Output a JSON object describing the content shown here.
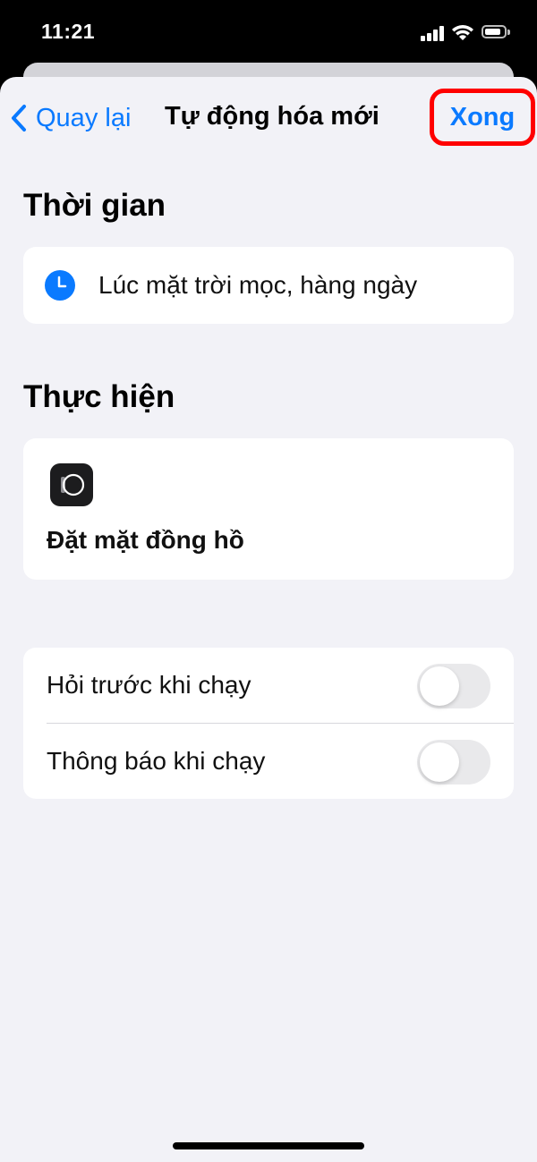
{
  "status_bar": {
    "time": "11:21",
    "signal_icon": "cellular-signal-icon",
    "wifi_icon": "wifi-icon",
    "battery_icon": "battery-icon"
  },
  "nav": {
    "back_icon": "chevron-left-icon",
    "back_label": "Quay lại",
    "title": "Tự động hóa mới",
    "done_label": "Xong"
  },
  "trigger": {
    "heading": "Thời gian",
    "icon": "clock-icon",
    "label": "Lúc mặt trời mọc, hàng ngày"
  },
  "action": {
    "heading": "Thực hiện",
    "icon": "watch-face-icon",
    "label": "Đặt mặt đồng hồ"
  },
  "options": [
    {
      "label": "Hỏi trước khi chạy",
      "enabled": false
    },
    {
      "label": "Thông báo khi chạy",
      "enabled": false
    }
  ],
  "colors": {
    "accent": "#0a7aff",
    "highlight_border": "#ff0000",
    "background": "#f2f2f7"
  }
}
